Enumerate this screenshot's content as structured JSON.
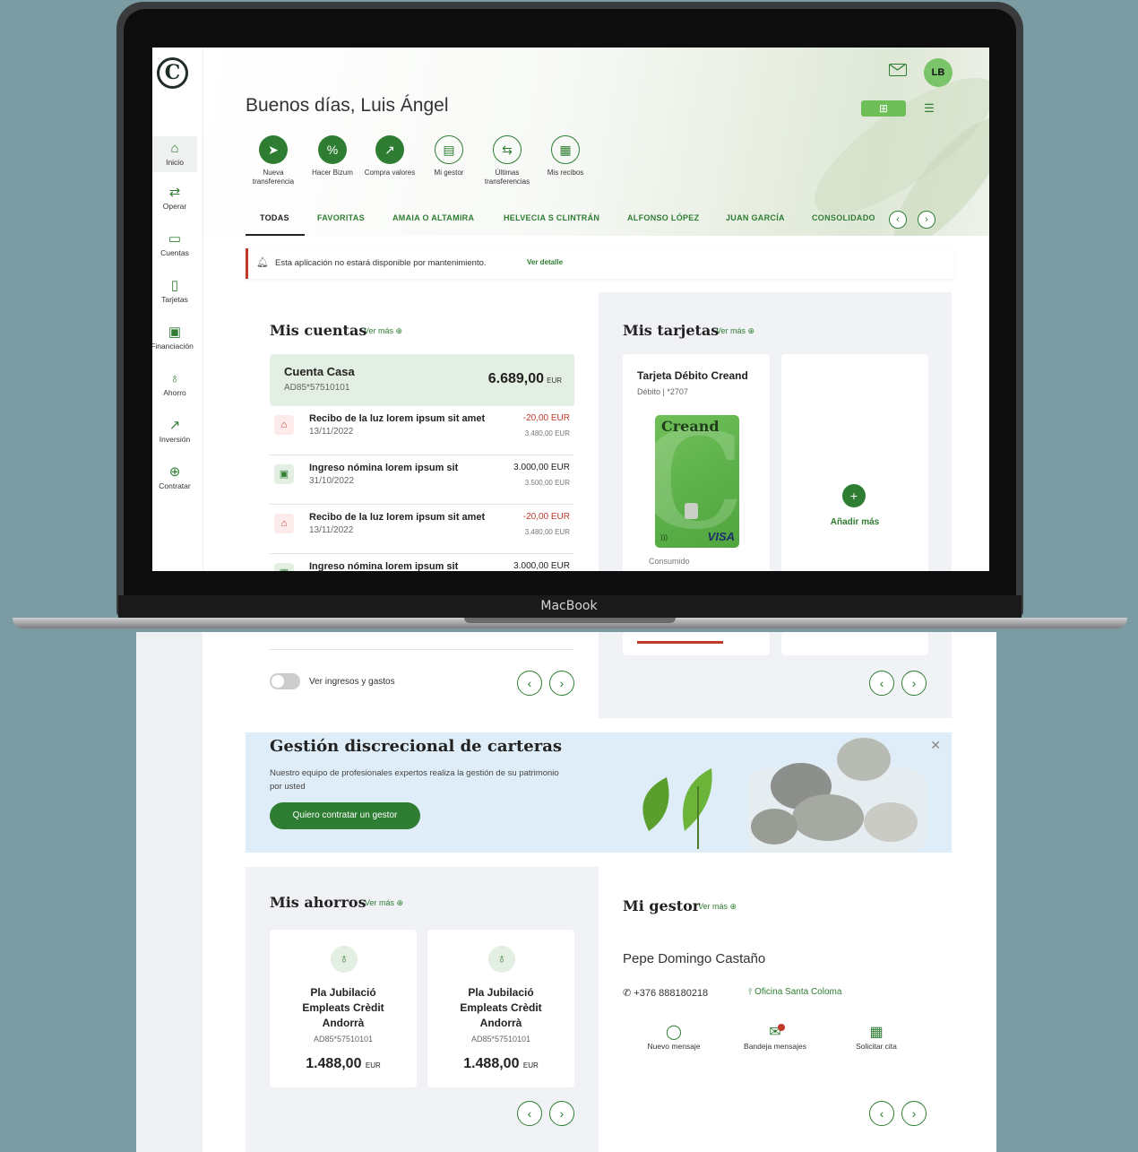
{
  "laptop": {
    "brand_label": "MacBook"
  },
  "sidebar": {
    "logo_letter": "C",
    "items": [
      {
        "label": "Inicio",
        "icon": "home-icon"
      },
      {
        "label": "Operar",
        "icon": "transfer-arrows-icon"
      },
      {
        "label": "Cuentas",
        "icon": "wallet-icon"
      },
      {
        "label": "Tarjetas",
        "icon": "card-icon"
      },
      {
        "label": "Financiación",
        "icon": "money-icon"
      },
      {
        "label": "Ahorro",
        "icon": "piggy-bank-icon"
      },
      {
        "label": "Inversión",
        "icon": "trend-up-icon"
      },
      {
        "label": "Contratar",
        "icon": "plus-circle-icon"
      }
    ]
  },
  "header": {
    "greeting": "Buenos días, Luis Ángel",
    "avatar_initials": "LB"
  },
  "quick_actions": [
    {
      "label": "Nueva transferencia"
    },
    {
      "label": "Hacer Bizum"
    },
    {
      "label": "Compra valores"
    },
    {
      "label": "Mi gestor"
    },
    {
      "label": "Últimas transferencias"
    },
    {
      "label": "Mis recibos"
    }
  ],
  "tabs": [
    "TODAS",
    "FAVORITAS",
    "AMAIA O ALTAMIRA",
    "HELVECIA S CLINTRÁN",
    "ALFONSO LÓPEZ",
    "JUAN GARCÍA",
    "CONSOLIDADO"
  ],
  "notice": {
    "text": "Esta aplicación no estará disponible por mantenimiento.",
    "link": "Ver detalle"
  },
  "accounts": {
    "title": "Mis cuentas",
    "ver_mas": "Ver más",
    "account_name": "Cuenta Casa",
    "account_number": "AD85*57510101",
    "balance": "6.689,00",
    "currency": "EUR",
    "transactions": [
      {
        "title": "Recibo de la luz lorem ipsum sit amet",
        "date": "13/11/2022",
        "amount": "-20,00 EUR",
        "balance": "3.480,00 EUR",
        "type": "expense"
      },
      {
        "title": "Ingreso nómina lorem ipsum sit",
        "date": "31/10/2022",
        "amount": "3.000,00 EUR",
        "balance": "3.500,00 EUR",
        "type": "income"
      },
      {
        "title": "Recibo de la luz lorem ipsum sit amet",
        "date": "13/11/2022",
        "amount": "-20,00 EUR",
        "balance": "3.480,00 EUR",
        "type": "expense"
      },
      {
        "title": "Ingreso nómina lorem ipsum sit",
        "date": "",
        "amount": "3.000,00 EUR",
        "balance": "",
        "type": "income"
      }
    ],
    "toggle_label": "Ver ingresos y gastos"
  },
  "cards": {
    "title": "Mis tarjetas",
    "ver_mas": "Ver más",
    "card_name": "Tarjeta Débito Creand",
    "card_detail": "Débito | *2707",
    "card_brand": "Creand",
    "card_network": "VISA",
    "consumed_label": "Consumido",
    "add_more": "Añadir más"
  },
  "promo": {
    "title": "Gestión discrecional de carteras",
    "text": "Nuestro equipo de profesionales expertos realiza la gestión de su patrimonio por usted",
    "button": "Quiero contratar un gestor"
  },
  "savings": {
    "title": "Mis ahorros",
    "ver_mas": "Ver más",
    "items": [
      {
        "name": "Pla Jubilació Empleats Crèdit Andorrà",
        "number": "AD85*57510101",
        "amount": "1.488,00",
        "currency": "EUR"
      },
      {
        "name": "Pla Jubilació Empleats Crèdit Andorrà",
        "number": "AD85*57510101",
        "amount": "1.488,00",
        "currency": "EUR"
      }
    ]
  },
  "manager": {
    "title": "Mi gestor",
    "ver_mas": "Ver más",
    "name": "Pepe Domingo Castaño",
    "phone": "+376 888180218",
    "office": "Oficina Santa Coloma",
    "actions": [
      {
        "label": "Nuevo mensaje",
        "icon": "chat-bubble-icon"
      },
      {
        "label": "Bandeja mensajes",
        "icon": "inbox-icon"
      },
      {
        "label": "Solicitar cita",
        "icon": "calendar-icon"
      }
    ]
  },
  "colors": {
    "brand_green": "#2e7d32",
    "background": "#7a9ba2",
    "alert_red": "#c0392b"
  }
}
